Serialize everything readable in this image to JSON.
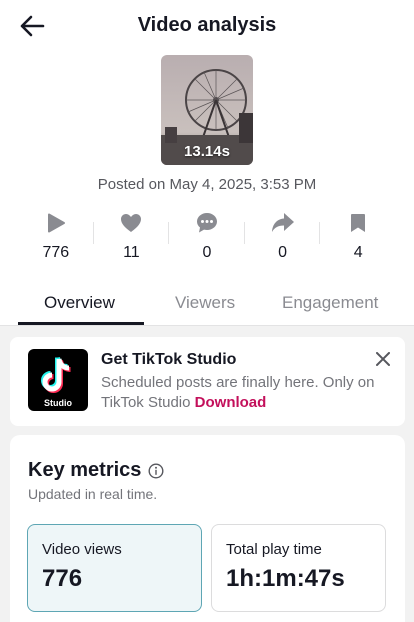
{
  "header": {
    "title": "Video analysis",
    "back_icon": "arrow-left-icon"
  },
  "video": {
    "duration": "13.14s",
    "posted": "Posted on May 4, 2025, 3:53 PM"
  },
  "stats": [
    {
      "icon": "play-icon",
      "value": "776"
    },
    {
      "icon": "heart-icon",
      "value": "11"
    },
    {
      "icon": "comment-icon",
      "value": "0"
    },
    {
      "icon": "share-icon",
      "value": "0"
    },
    {
      "icon": "bookmark-icon",
      "value": "4"
    }
  ],
  "tabs": [
    {
      "label": "Overview",
      "active": true
    },
    {
      "label": "Viewers",
      "active": false
    },
    {
      "label": "Engagement",
      "active": false
    }
  ],
  "promo": {
    "logo_label": "Studio",
    "title": "Get TikTok Studio",
    "text": "Scheduled posts are finally here. Only on TikTok Studio",
    "link": "Download",
    "close_icon": "close-icon"
  },
  "metrics": {
    "title": "Key metrics",
    "subtitle": "Updated in real time.",
    "items": [
      {
        "label": "Video views",
        "value": "776",
        "selected": true
      },
      {
        "label": "Total play time",
        "value": "1h:1m:47s",
        "selected": false
      }
    ]
  },
  "colors": {
    "accent_link": "#c3105b",
    "selected_card_bg": "#eef6f8",
    "selected_card_border": "#5ea6b4"
  }
}
